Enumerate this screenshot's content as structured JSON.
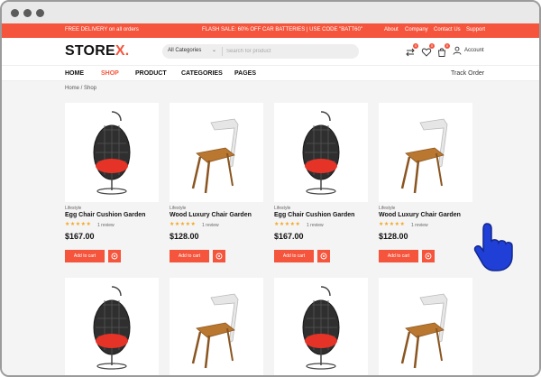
{
  "topbar": {
    "promo": "FREE DELIVERY on all orders",
    "flash": "FLASH SALE: 60% OFF CAR BATTERIES | USE CODE \"BATT60\"",
    "links": [
      "About",
      "Company",
      "Contact Us",
      "Support"
    ]
  },
  "header": {
    "logo_main": "STORE",
    "logo_accent": "X.",
    "search_category": "All Categories",
    "search_placeholder": "Search for product",
    "compare_count": "0",
    "wishlist_count": "0",
    "cart_count": "0",
    "account_label": "Account"
  },
  "nav": {
    "items": [
      "HOME",
      "SHOP",
      "PRODUCT",
      "CATEGORIES",
      "PAGES"
    ],
    "active": "SHOP",
    "track_order": "Track Order"
  },
  "breadcrumb": "Home / Shop",
  "products": [
    {
      "category": "Lifestyle",
      "name": "Egg Chair Cushion Garden",
      "stars": "★★★★★",
      "reviews": "1 review",
      "price": "$167.00",
      "add_to_cart": "Add to cart",
      "image": "egg-chair"
    },
    {
      "category": "Lifestyle",
      "name": "Wood Luxury Chair Garden",
      "stars": "★★★★★",
      "reviews": "1 review",
      "price": "$128.00",
      "add_to_cart": "Add to cart",
      "image": "wood-chair"
    },
    {
      "category": "Lifestyle",
      "name": "Egg Chair Cushion Garden",
      "stars": "★★★★★",
      "reviews": "1 review",
      "price": "$167.00",
      "add_to_cart": "Add to cart",
      "image": "egg-chair"
    },
    {
      "category": "Lifestyle",
      "name": "Wood Luxury Chair Garden",
      "stars": "★★★★★",
      "reviews": "1 review",
      "price": "$128.00",
      "add_to_cart": "Add to cart",
      "image": "wood-chair"
    }
  ],
  "colors": {
    "accent": "#f4553c",
    "cursor": "#1f3fd6",
    "star": "#f5a623"
  }
}
